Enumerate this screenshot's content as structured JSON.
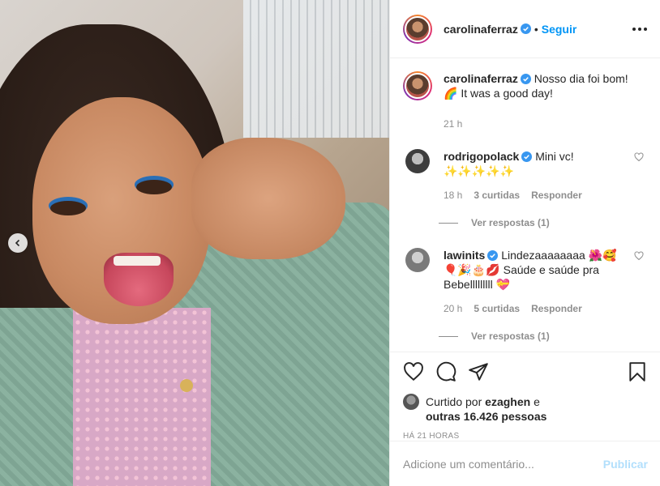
{
  "post": {
    "author": "carolinaferraz",
    "follow_label": "Seguir",
    "dot": "•",
    "caption_line1": "Nosso dia foi bom!",
    "caption_line2": "🌈 It was a good day!",
    "caption_time": "21 h"
  },
  "comments": [
    {
      "username": "rodrigopolack",
      "text_line1": "Mini vc!",
      "text_line2": "✨✨✨✨✨",
      "time": "18 h",
      "likes": "3 curtidas",
      "reply_label": "Responder",
      "view_replies": "Ver respostas (1)"
    },
    {
      "username": "lawinits",
      "text_line1": "Lindezaaaaaaaa 🌺🥰",
      "text_line2": "🎈🎉🎂💋 Saúde e saúde pra",
      "text_line3": "Bebelllllllll 💝",
      "time": "20 h",
      "likes": "5 curtidas",
      "reply_label": "Responder",
      "view_replies": "Ver respostas (1)"
    }
  ],
  "likes": {
    "prefix": "Curtido por",
    "user": "ezaghen",
    "joiner": "e",
    "others": "outras 16.426 pessoas"
  },
  "timestamp": "HÁ 21 HORAS",
  "add_comment": {
    "placeholder": "Adicione um comentário...",
    "publish_label": "Publicar"
  },
  "icons": {
    "like": "heart-icon",
    "comment": "comment-icon",
    "share": "share-icon",
    "save": "bookmark-icon",
    "more": "more-icon",
    "prev": "chevron-left-icon",
    "verified": "verified-badge-icon"
  },
  "colors": {
    "link": "#0095f6",
    "verified": "#3897f0",
    "muted": "#8e8e8e",
    "publish_disabled": "#b2dffc"
  }
}
